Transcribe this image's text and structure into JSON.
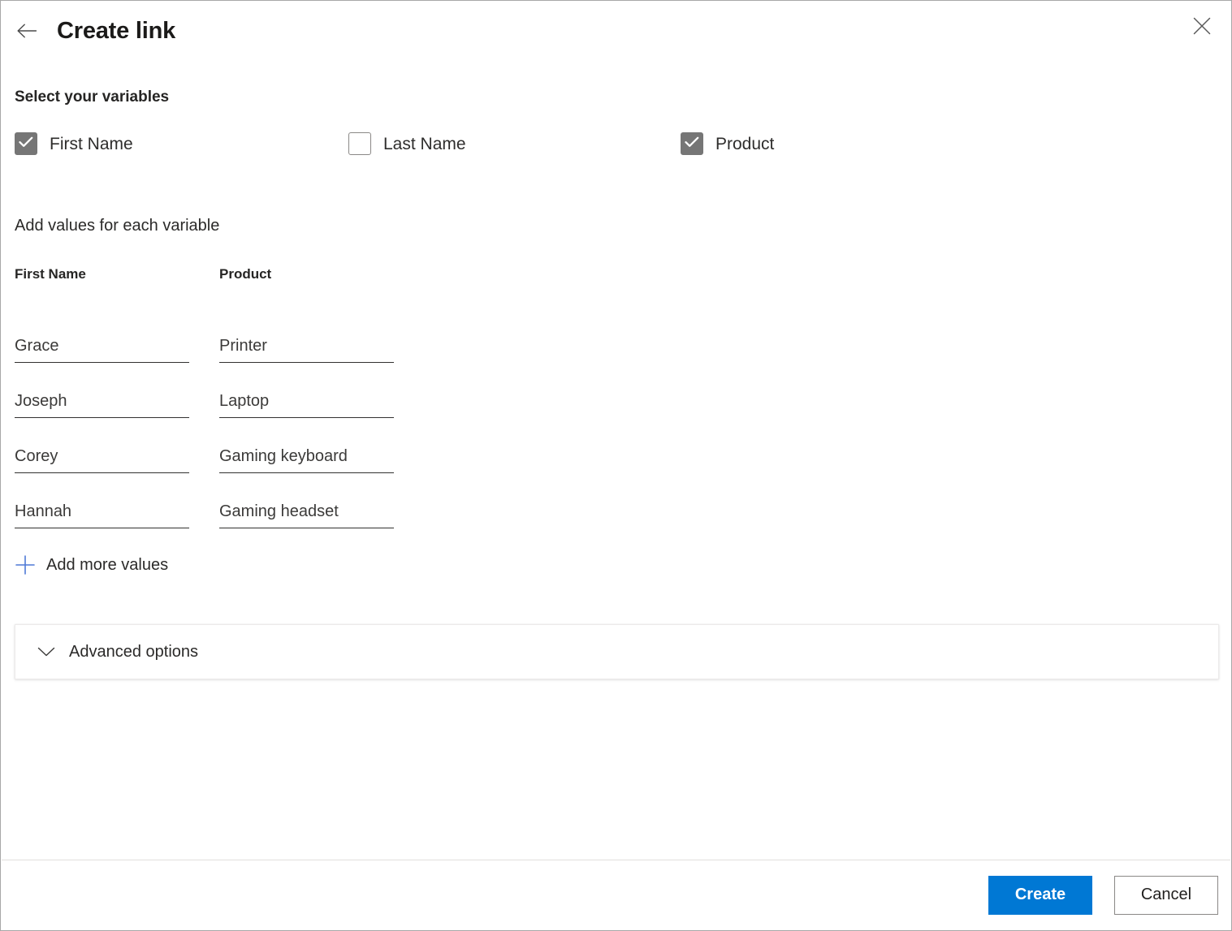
{
  "header": {
    "title": "Create link",
    "back_icon": "arrow-left-icon",
    "close_icon": "close-icon"
  },
  "variables_section": {
    "heading": "Select your variables",
    "checkboxes": [
      {
        "label": "First Name",
        "checked": true
      },
      {
        "label": "Last Name",
        "checked": false
      },
      {
        "label": "Product",
        "checked": true
      }
    ]
  },
  "values_section": {
    "heading": "Add values for each variable",
    "columns": [
      {
        "header": "First Name",
        "values": [
          "Grace",
          "Joseph",
          "Corey",
          "Hannah"
        ]
      },
      {
        "header": "Product",
        "values": [
          "Printer",
          "Laptop",
          "Gaming keyboard",
          "Gaming headset"
        ]
      }
    ],
    "add_more_label": "Add more values",
    "add_more_icon": "plus-icon"
  },
  "advanced": {
    "label": "Advanced options",
    "icon": "chevron-down-icon",
    "expanded": false
  },
  "footer": {
    "create_label": "Create",
    "cancel_label": "Cancel"
  },
  "colors": {
    "accent": "#0078d4",
    "checkbox_checked": "#767676",
    "checkbox_border": "#8a8886",
    "text": "#201f1e",
    "input_underline": "#323130"
  }
}
